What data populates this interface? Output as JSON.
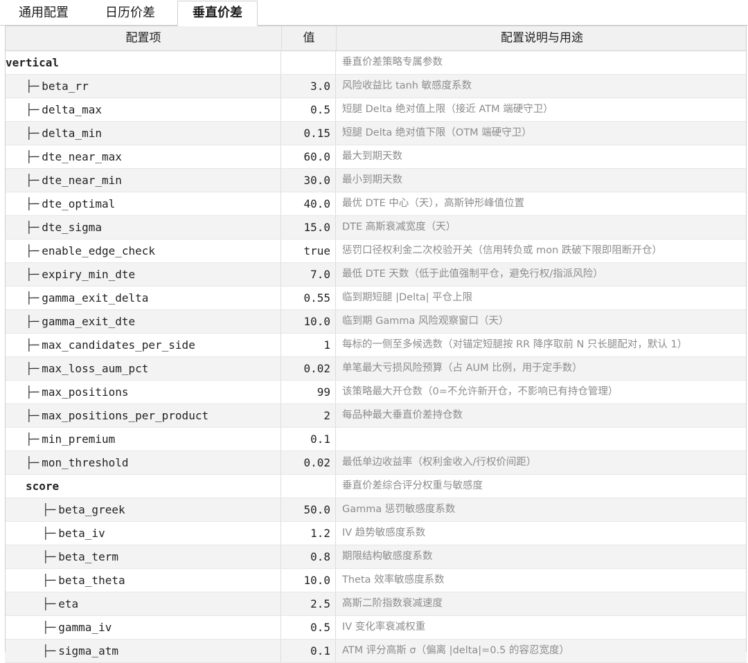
{
  "tabs": [
    {
      "label": "通用配置",
      "active": false
    },
    {
      "label": "日历价差",
      "active": false
    },
    {
      "label": "垂直价差",
      "active": true
    }
  ],
  "table": {
    "headers": [
      "配置项",
      "值",
      "配置说明与用途"
    ],
    "rows": [
      {
        "key": "vertical",
        "depth": 0,
        "group": true,
        "value": "",
        "desc": "垂直价差策略专属参数"
      },
      {
        "key": "beta_rr",
        "depth": 1,
        "group": false,
        "value": "3.0",
        "desc": "风险收益比 tanh 敏感度系数"
      },
      {
        "key": "delta_max",
        "depth": 1,
        "group": false,
        "value": "0.5",
        "desc": "短腿 Delta 绝对值上限（接近 ATM 端硬守卫）"
      },
      {
        "key": "delta_min",
        "depth": 1,
        "group": false,
        "value": "0.15",
        "desc": "短腿 Delta 绝对值下限（OTM 端硬守卫）"
      },
      {
        "key": "dte_near_max",
        "depth": 1,
        "group": false,
        "value": "60.0",
        "desc": "最大到期天数"
      },
      {
        "key": "dte_near_min",
        "depth": 1,
        "group": false,
        "value": "30.0",
        "desc": "最小到期天数"
      },
      {
        "key": "dte_optimal",
        "depth": 1,
        "group": false,
        "value": "40.0",
        "desc": "最优 DTE 中心（天），高斯钟形峰值位置"
      },
      {
        "key": "dte_sigma",
        "depth": 1,
        "group": false,
        "value": "15.0",
        "desc": "DTE 高斯衰减宽度（天）"
      },
      {
        "key": "enable_edge_check",
        "depth": 1,
        "group": false,
        "value": "true",
        "desc": "惩罚口径权利金二次校验开关（信用转负或 mon 跌破下限即阻断开仓）"
      },
      {
        "key": "expiry_min_dte",
        "depth": 1,
        "group": false,
        "value": "7.0",
        "desc": "最低 DTE 天数（低于此值强制平仓，避免行权/指派风险）"
      },
      {
        "key": "gamma_exit_delta",
        "depth": 1,
        "group": false,
        "value": "0.55",
        "desc": "临到期短腿 |Delta| 平仓上限"
      },
      {
        "key": "gamma_exit_dte",
        "depth": 1,
        "group": false,
        "value": "10.0",
        "desc": "临到期 Gamma 风险观察窗口（天）"
      },
      {
        "key": "max_candidates_per_side",
        "depth": 1,
        "group": false,
        "value": "1",
        "desc": "每标的一侧至多候选数（对锚定短腿按 RR 降序取前 N 只长腿配对，默认 1）"
      },
      {
        "key": "max_loss_aum_pct",
        "depth": 1,
        "group": false,
        "value": "0.02",
        "desc": "单笔最大亏损风险预算（占 AUM 比例，用于定手数）"
      },
      {
        "key": "max_positions",
        "depth": 1,
        "group": false,
        "value": "99",
        "desc": "该策略最大开仓数（0=不允许新开仓，不影响已有持仓管理）"
      },
      {
        "key": "max_positions_per_product",
        "depth": 1,
        "group": false,
        "value": "2",
        "desc": "每品种最大垂直价差持仓数"
      },
      {
        "key": "min_premium",
        "depth": 1,
        "group": false,
        "value": "0.1",
        "desc": ""
      },
      {
        "key": "mon_threshold",
        "depth": 1,
        "group": false,
        "value": "0.02",
        "desc": "最低单边收益率（权利金收入/行权价间距）"
      },
      {
        "key": "score",
        "depth": 1,
        "group": true,
        "value": "",
        "desc": "垂直价差综合评分权重与敏感度"
      },
      {
        "key": "beta_greek",
        "depth": 2,
        "group": false,
        "value": "50.0",
        "desc": "Gamma 惩罚敏感度系数"
      },
      {
        "key": "beta_iv",
        "depth": 2,
        "group": false,
        "value": "1.2",
        "desc": "IV 趋势敏感度系数"
      },
      {
        "key": "beta_term",
        "depth": 2,
        "group": false,
        "value": "0.8",
        "desc": "期限结构敏感度系数"
      },
      {
        "key": "beta_theta",
        "depth": 2,
        "group": false,
        "value": "10.0",
        "desc": "Theta 效率敏感度系数"
      },
      {
        "key": "eta",
        "depth": 2,
        "group": false,
        "value": "2.5",
        "desc": "高斯二阶指数衰减速度"
      },
      {
        "key": "gamma_iv",
        "depth": 2,
        "group": false,
        "value": "0.5",
        "desc": "IV 变化率衰减权重"
      },
      {
        "key": "sigma_atm",
        "depth": 2,
        "group": false,
        "value": "0.1",
        "desc": "ATM 评分高斯 σ（偏离 |delta|=0.5 的容忍宽度）"
      }
    ]
  }
}
